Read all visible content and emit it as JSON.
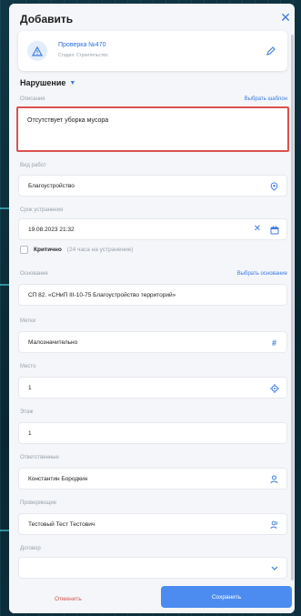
{
  "header": {
    "title": "Добавить"
  },
  "card": {
    "title": "Проверка №470",
    "subtitle": "Стадия: Строительство"
  },
  "section": {
    "title": "Нарушение"
  },
  "description": {
    "label": "Описание",
    "template_link": "Выбрать шаблон",
    "value": "Отсутствует уборка мусора"
  },
  "work_type": {
    "label": "Вид работ",
    "value": "Благоустройство"
  },
  "deadline": {
    "label": "Срок устранения",
    "value": "19.08.2023 21:32"
  },
  "critical": {
    "label": "Критично",
    "hint": "(24 часа на устранение)",
    "checked": false
  },
  "basis": {
    "label": "Основание",
    "link": "Выбрать основание",
    "value": "СП 82. «СНиП III-10-75 Благоустройство территорий»"
  },
  "tags": {
    "label": "Метки",
    "value": "Малозначительно"
  },
  "place": {
    "label": "Место",
    "value": "1"
  },
  "floor": {
    "label": "Этаж",
    "value": "1"
  },
  "responsible": {
    "label": "Ответственные",
    "value": "Константин Бородкин"
  },
  "inspectors": {
    "label": "Проверяющие",
    "value": "Тестовый Тест Тестович"
  },
  "contract": {
    "label": "Договор",
    "value": ""
  },
  "footer": {
    "cancel": "Отменить",
    "save": "Сохранить"
  },
  "colors": {
    "accent": "#3c7be3",
    "danger": "#d9534f",
    "primary_button": "#4c8cf0"
  },
  "icons": [
    "close-icon",
    "warning-icon",
    "pencil-icon",
    "chevron-down-icon",
    "map-pin-icon",
    "clear-icon",
    "calendar-icon",
    "hash-icon",
    "target-icon",
    "user-icon",
    "users-icon"
  ]
}
